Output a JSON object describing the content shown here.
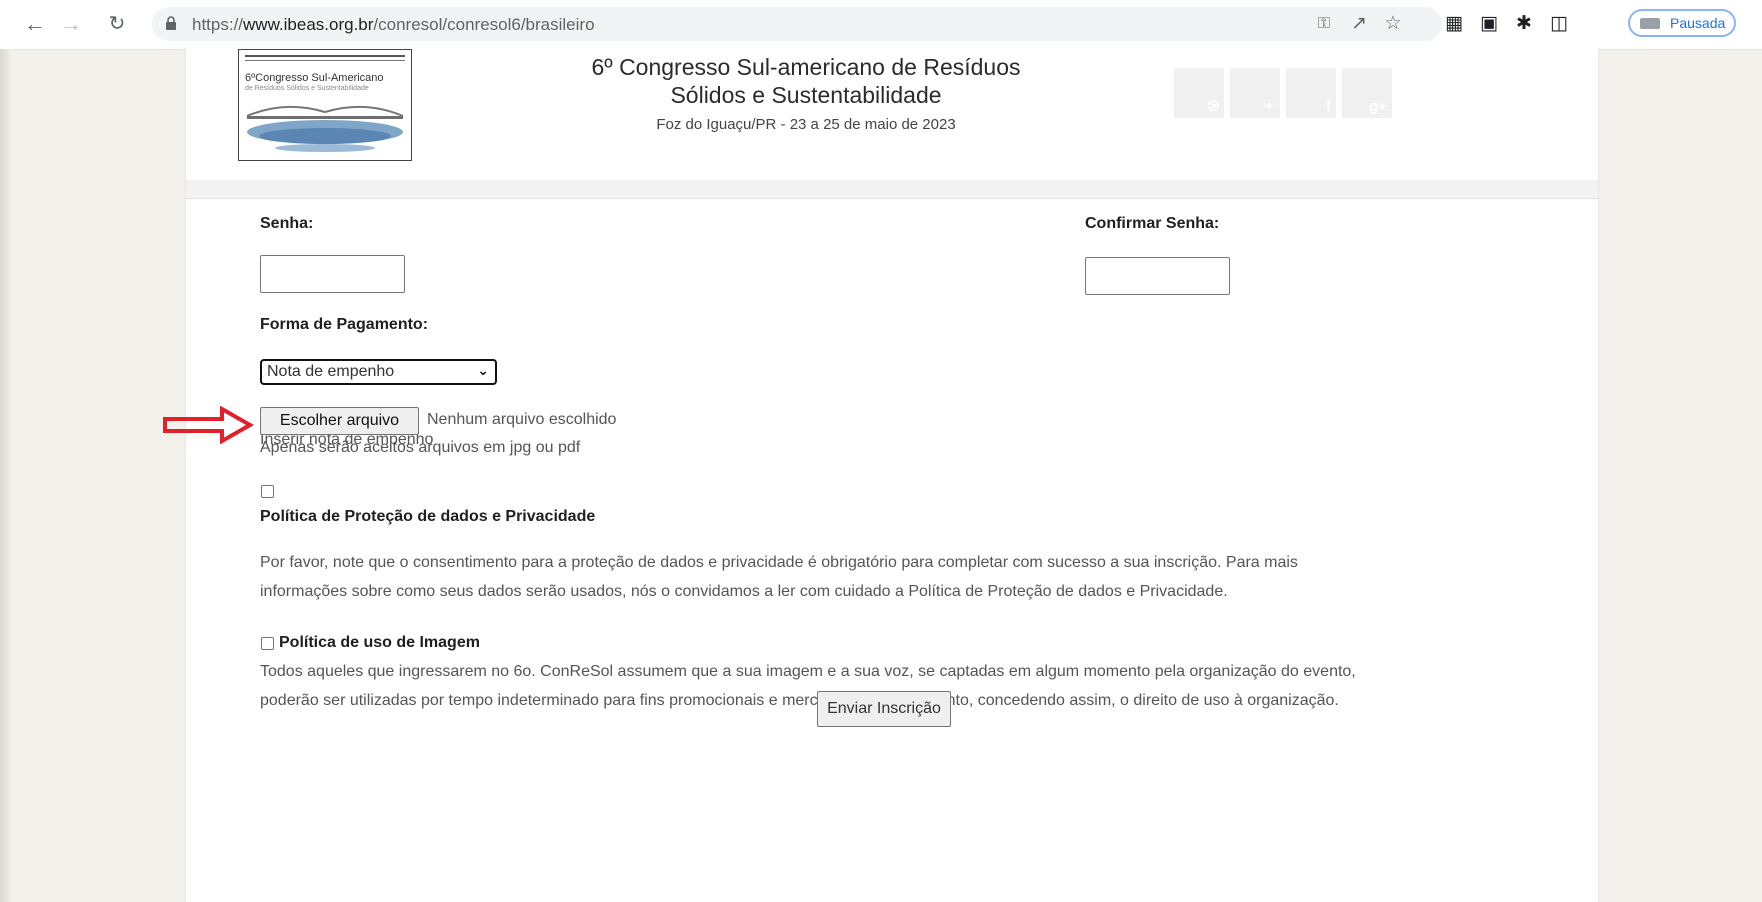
{
  "browser": {
    "url_scheme": "https://",
    "url_domain": "www.ibeas.org.br",
    "url_path": "/conresol/conresol6/brasileiro",
    "profile_label": "Pausada"
  },
  "header": {
    "logo_title": "6ºCongresso Sul-Americano",
    "logo_subtitle": "de Resíduos Sólidos e Sustentabilidade",
    "title_line1": "6º Congresso Sul-americano de Resíduos",
    "title_line2": "Sólidos e Sustentabilidade",
    "subtitle": "Foz do Iguaçu/PR - 23 a 25 de maio de 2023",
    "social_icons": [
      "rss-icon",
      "twitter-icon",
      "facebook-icon",
      "google-plus-icon"
    ],
    "social_glyphs": [
      "⧁",
      "❧",
      "f",
      "g+"
    ]
  },
  "form": {
    "password_label": "Senha:",
    "password_value": "",
    "confirm_password_label": "Confirmar Senha:",
    "confirm_password_value": "",
    "payment_label": "Forma de Pagamento:",
    "payment_selected": "Nota de empenho",
    "upload_label": "Inserir nota de empenho",
    "file_button_label": "Escolher arquivo",
    "file_status": "Nenhum arquivo escolhido",
    "file_hint": "Apenas serão aceitos arquivos em jpg ou pdf",
    "privacy_title": "Política de Proteção de dados e Privacidade",
    "privacy_text_line1": "Por favor, note que o consentimento para a proteção de dados e privacidade é obrigatório para completar com sucesso a sua inscrição. Para mais",
    "privacy_text_line2": "informações sobre como seus dados serão usados, nós o convidamos a ler com cuidado a Política de Proteção de dados e Privacidade.",
    "image_policy_title": "Política de uso de Imagem",
    "image_policy_line1": "Todos aqueles que ingressarem no 6o. ConReSol assumem que a sua imagem e a sua voz, se captadas em algum momento pela organização do evento,",
    "image_policy_line2": "poderão ser utilizadas por tempo indeterminado para fins promocionais e mercadológicos do evento, concedendo assim, o direito de uso à organização.",
    "submit_label": "Enviar Inscrição"
  },
  "colors": {
    "annotation_arrow": "#e0202a",
    "page_background": "#f2f1ec"
  }
}
